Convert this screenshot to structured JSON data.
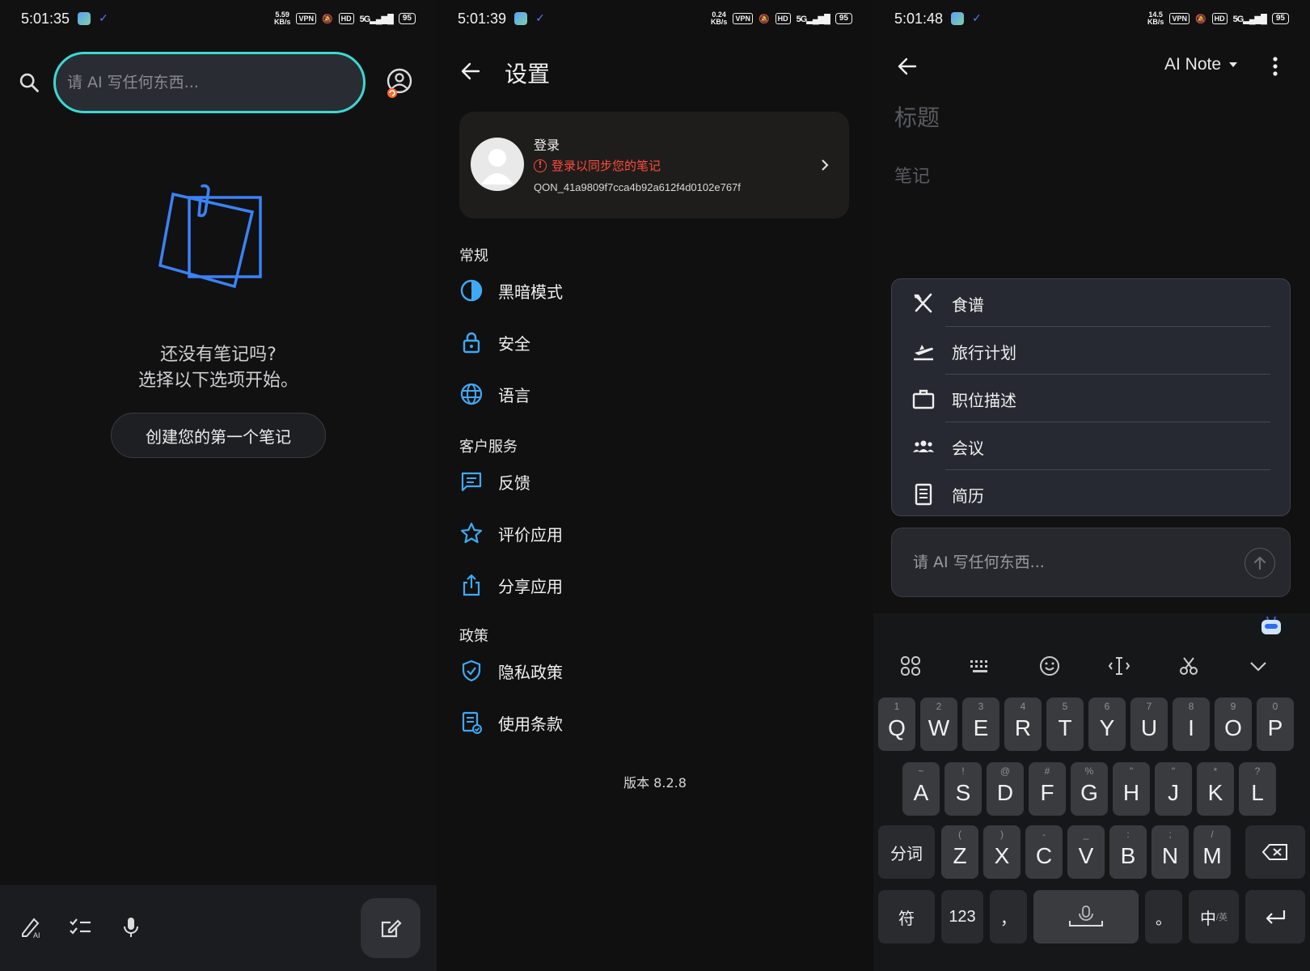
{
  "screen1": {
    "status": {
      "time": "5:01:35",
      "speed_top": "5.59",
      "speed_bottom": "KB/s",
      "vpn": "VPN",
      "hd": "HD",
      "net": "5G",
      "battery": "95"
    },
    "search": {
      "placeholder": "请 AI 写任何东西..."
    },
    "empty": {
      "line1": "还没有笔记吗?",
      "line2": "选择以下选项开始。"
    },
    "create_button": "创建您的第一个笔记",
    "bottom_icons": [
      "handwriting-icon",
      "checklist-icon",
      "microphone-icon",
      "compose-icon"
    ]
  },
  "screen2": {
    "status": {
      "time": "5:01:39",
      "speed_top": "0.24",
      "speed_bottom": "KB/s",
      "vpn": "VPN",
      "hd": "HD",
      "net": "5G",
      "battery": "95"
    },
    "title": "设置",
    "account": {
      "login": "登录",
      "warning": "登录以同步您的笔记",
      "id": "QON_41a9809f7cca4b92a612f4d0102e767f"
    },
    "sections": {
      "general": "常规",
      "support": "客户服务",
      "policy": "政策"
    },
    "items": {
      "dark_mode": "黑暗模式",
      "security": "安全",
      "language": "语言",
      "feedback": "反馈",
      "rate": "评价应用",
      "share": "分享应用",
      "privacy": "隐私政策",
      "terms": "使用条款"
    },
    "version": "版本 8.2.8",
    "accent_color": "#3fa9f5"
  },
  "screen3": {
    "status": {
      "time": "5:01:48",
      "speed_top": "14.5",
      "speed_bottom": "KB/s",
      "vpn": "VPN",
      "hd": "HD",
      "net": "5G",
      "battery": "95"
    },
    "model_selector": "AI Note",
    "title_placeholder": "标题",
    "note_placeholder": "笔记",
    "templates": [
      "食谱",
      "旅行计划",
      "职位描述",
      "会议",
      "简历"
    ],
    "prompt": {
      "placeholder": "请 AI 写任何东西..."
    },
    "keyboard": {
      "row1": [
        {
          "k": "Q",
          "s": "1"
        },
        {
          "k": "W",
          "s": "2"
        },
        {
          "k": "E",
          "s": "3"
        },
        {
          "k": "R",
          "s": "4"
        },
        {
          "k": "T",
          "s": "5"
        },
        {
          "k": "Y",
          "s": "6"
        },
        {
          "k": "U",
          "s": "7"
        },
        {
          "k": "I",
          "s": "8"
        },
        {
          "k": "O",
          "s": "9"
        },
        {
          "k": "P",
          "s": "0"
        }
      ],
      "row2": [
        {
          "k": "A",
          "s": "~"
        },
        {
          "k": "S",
          "s": "!"
        },
        {
          "k": "D",
          "s": "@"
        },
        {
          "k": "F",
          "s": "#"
        },
        {
          "k": "G",
          "s": "%"
        },
        {
          "k": "H",
          "s": "\""
        },
        {
          "k": "J",
          "s": "\""
        },
        {
          "k": "K",
          "s": "*"
        },
        {
          "k": "L",
          "s": "?"
        }
      ],
      "row3": [
        {
          "k": "Z",
          "s": "("
        },
        {
          "k": "X",
          "s": ")"
        },
        {
          "k": "C",
          "s": "-"
        },
        {
          "k": "V",
          "s": "_"
        },
        {
          "k": "B",
          "s": ":"
        },
        {
          "k": "N",
          "s": ";"
        },
        {
          "k": "M",
          "s": "/"
        }
      ],
      "fenci": "分词",
      "fu": "符",
      "num": "123",
      "comma": "，",
      "period": "。",
      "zh": "中",
      "zh_sub": "/英"
    }
  }
}
